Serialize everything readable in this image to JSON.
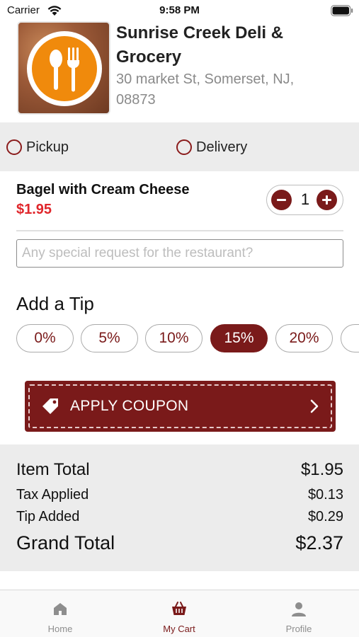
{
  "status_bar": {
    "carrier": "Carrier",
    "time": "9:58 PM",
    "icons": [
      "wifi-icon",
      "battery-icon"
    ]
  },
  "restaurant": {
    "name": "Sunrise Creek Deli & Grocery",
    "address": "30 market St, Somerset, NJ, 08873",
    "logo_icon": "spoon-fork-logo"
  },
  "order_type": {
    "options": [
      {
        "label": "Pickup",
        "selected": false
      },
      {
        "label": "Delivery",
        "selected": false
      }
    ]
  },
  "cart": {
    "items": [
      {
        "name": "Bagel with Cream Cheese",
        "price": "$1.95",
        "quantity": "1"
      }
    ],
    "special_request_placeholder": "Any special request for the restaurant?"
  },
  "tip": {
    "title": "Add a Tip",
    "options": [
      "0%",
      "5%",
      "10%",
      "15%",
      "20%"
    ],
    "selected": "15%"
  },
  "coupon": {
    "label": "APPLY COUPON",
    "icon": "tag-icon"
  },
  "totals": {
    "item_total_label": "Item Total",
    "item_total_value": "$1.95",
    "tax_label": "Tax Applied",
    "tax_value": "$0.13",
    "tip_label": "Tip Added",
    "tip_value": "$0.29",
    "grand_total_label": "Grand Total",
    "grand_total_value": "$2.37"
  },
  "tab_bar": {
    "tabs": [
      {
        "label": "Home",
        "icon": "home-icon",
        "active": false
      },
      {
        "label": "My Cart",
        "icon": "basket-icon",
        "active": true
      },
      {
        "label": "Profile",
        "icon": "person-icon",
        "active": false
      }
    ]
  },
  "colors": {
    "brand": "#7a1a1a",
    "price_red": "#e0262b",
    "panel_gray": "#ececec",
    "logo_orange": "#f08a0c"
  }
}
